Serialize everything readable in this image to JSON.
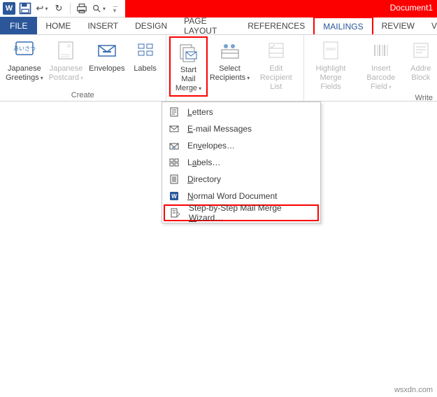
{
  "title": "Document1",
  "tabs": {
    "file": "FILE",
    "home": "HOME",
    "insert": "INSERT",
    "design": "DESIGN",
    "pagelayout": "PAGE LAYOUT",
    "references": "REFERENCES",
    "mailings": "MAILINGS",
    "review": "REVIEW",
    "view_initial": "V"
  },
  "ribbon": {
    "create_group": "Create",
    "japanese_greetings": "Japanese\nGreetings",
    "japanese_postcard": "Japanese\nPostcard",
    "envelopes": "Envelopes",
    "labels": "Labels",
    "start_mail_merge": "Start Mail\nMerge",
    "select_recipients": "Select\nRecipients",
    "edit_recipient_list": "Edit\nRecipient List",
    "highlight_merge_fields": "Highlight\nMerge Fields",
    "insert_barcode_field": "Insert Barcode\nField",
    "address_block": "Addre\nBlock",
    "write_group": "Write"
  },
  "menu": {
    "letters": "Letters",
    "email": "E-mail Messages",
    "envelopes": "Envelopes…",
    "labels": "Labels…",
    "directory": "Directory",
    "normal": "Normal Word Document",
    "wizard": "Step-by-Step Mail Merge Wizard…"
  },
  "watermark": "wsxdn.com"
}
